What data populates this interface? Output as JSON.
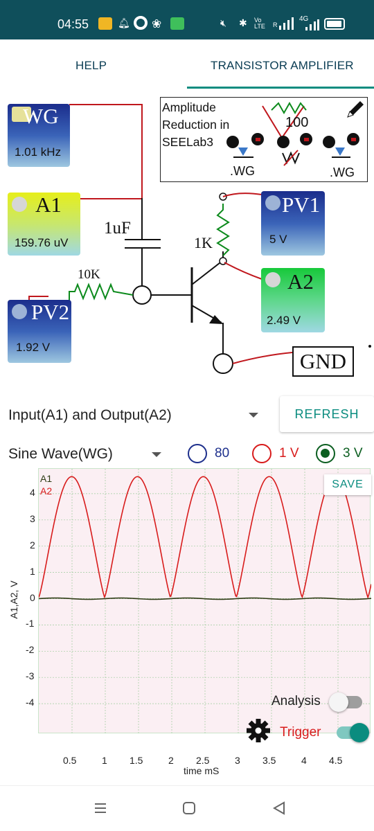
{
  "status_bar": {
    "time": "04:55",
    "network_label": "4G",
    "lte_label": "Vo LTE",
    "signal_r_label": "R"
  },
  "tabs": [
    {
      "label": "HELP",
      "active": false
    },
    {
      "label": "TRANSISTOR AMPLIFIER",
      "active": true
    }
  ],
  "schematic": {
    "wg": {
      "name": "WG",
      "value": "1.01 kHz"
    },
    "a1": {
      "name": "A1",
      "value": "159.76 uV"
    },
    "pv1": {
      "name": "PV1",
      "value": "5 V"
    },
    "a2": {
      "name": "A2",
      "value": "2.49 V"
    },
    "pv2": {
      "name": "PV2",
      "value": "1.92 V"
    },
    "capacitor_label": "1uF",
    "resistor_base_label": "10K",
    "resistor_collector_label": "1K",
    "ground_label": "GND",
    "info_box": {
      "lines": [
        "Amplitude",
        "Reduction in",
        "SEELab3"
      ],
      "resistor_value": "100",
      "left_label": ".WG",
      "right_label": ".WG"
    }
  },
  "controls": {
    "plot_select": "Input(A1) and Output(A2)",
    "refresh_label": "REFRESH",
    "waveform_select": "Sine Wave(WG)",
    "amplitude_options": [
      {
        "label": "80",
        "selected": false,
        "color": "#1d2f8c"
      },
      {
        "label": "1 V",
        "selected": false,
        "color": "#d81b1b"
      },
      {
        "label": "3 V",
        "selected": true,
        "color": "#0b5e20"
      }
    ]
  },
  "plot": {
    "save_label": "SAVE",
    "analysis_label": "Analysis",
    "trigger_label": "Trigger",
    "analysis_on": false,
    "trigger_on": true
  },
  "chart_data": {
    "type": "line",
    "title": "",
    "xlabel": "time mS",
    "ylabel": "A1,A2, V",
    "xlim": [
      0,
      5
    ],
    "ylim": [
      -5,
      5
    ],
    "x_ticks": [
      "0.5",
      "1",
      "1.5",
      "2",
      "2.5",
      "3",
      "3.5",
      "4",
      "4.5"
    ],
    "y_ticks": [
      "4",
      "3",
      "2",
      "1",
      "0",
      "-1",
      "-2",
      "-3",
      "-4"
    ],
    "legend": [
      "A1",
      "A2"
    ],
    "legend_placement": "top-left",
    "grid": true,
    "series": [
      {
        "name": "A1",
        "color": "#2e3b14",
        "x": [
          0.0,
          0.5,
          1.0,
          1.5,
          2.0,
          2.5,
          3.0,
          3.5,
          4.0,
          4.5,
          5.0
        ],
        "values": [
          0.0,
          0.02,
          -0.02,
          0.01,
          -0.02,
          0.02,
          -0.01,
          0.02,
          -0.02,
          0.01,
          0.0
        ]
      },
      {
        "name": "A2",
        "color": "#d81b1b",
        "x": [
          0.0,
          0.13,
          0.25,
          0.38,
          0.5,
          0.62,
          0.74,
          0.87,
          0.99,
          1.11,
          1.24,
          1.36,
          1.48,
          1.61,
          1.73,
          1.85,
          1.98,
          2.1,
          2.22,
          2.35,
          2.47,
          2.59,
          2.72,
          2.84,
          2.96,
          3.09,
          3.21,
          3.33,
          3.46,
          3.58,
          3.7,
          3.83,
          3.95,
          4.07,
          4.2,
          4.32,
          4.44,
          4.57,
          4.69,
          4.81,
          4.94
        ],
        "values": [
          0.0,
          2.1,
          4.0,
          4.6,
          4.0,
          2.1,
          0.2,
          0.05,
          0.2,
          2.1,
          4.0,
          4.6,
          4.0,
          2.1,
          0.2,
          0.05,
          0.2,
          2.1,
          4.0,
          4.6,
          4.0,
          2.1,
          0.2,
          0.05,
          0.2,
          2.1,
          4.0,
          4.6,
          4.0,
          2.1,
          0.2,
          0.05,
          0.2,
          2.1,
          4.0,
          4.6,
          4.0,
          2.1,
          0.2,
          0.05,
          0.2
        ]
      }
    ]
  },
  "colors": {
    "accent": "#0a8c7f",
    "status_bar": "#0f4f5b",
    "wire": "#c0171d"
  }
}
